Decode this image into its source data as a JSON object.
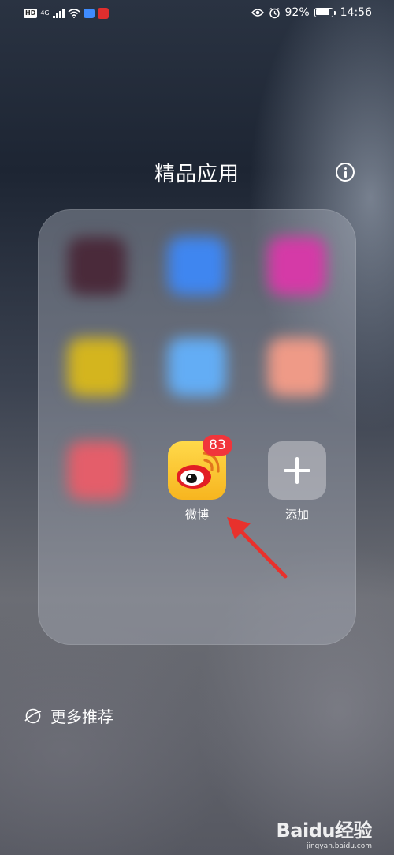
{
  "status_bar": {
    "hd": "HD",
    "network": "4G",
    "battery_percent": "92%",
    "battery_level": 0.92,
    "time": "14:56"
  },
  "folder": {
    "title": "精品应用",
    "apps": [
      {
        "label": "微博",
        "badge": "83",
        "icon": "weibo-icon"
      },
      {
        "label": "添加",
        "icon": "plus-icon"
      }
    ],
    "blurred_colors": [
      "#4a2a3a",
      "#3f86f0",
      "#d53aa7",
      "#d4b51e",
      "#63adf5",
      "#ef9a87",
      "#e45e6a"
    ]
  },
  "footer": {
    "more_label": "更多推荐"
  },
  "watermark": {
    "logo": "Baidu经验",
    "url": "jingyan.baidu.com"
  },
  "colors": {
    "badge_red": "#f1353b",
    "weibo_yellow": "#f7b51f",
    "arrow_red": "#e8312c"
  }
}
